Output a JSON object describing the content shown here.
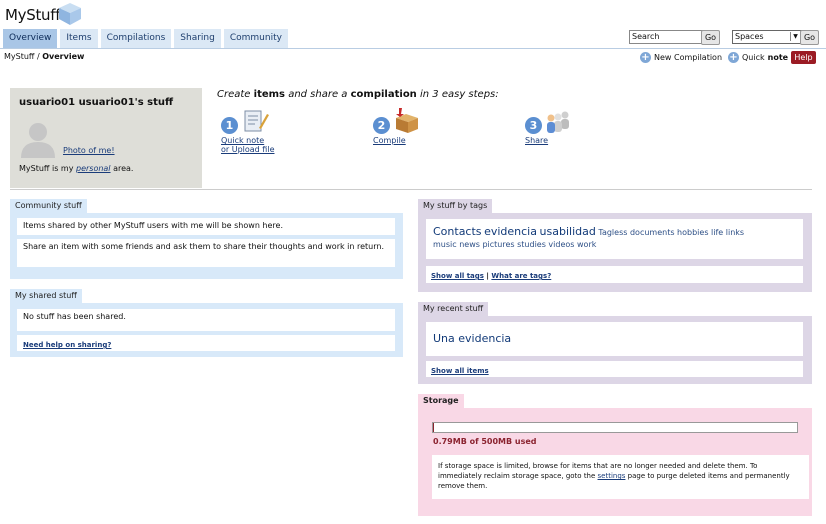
{
  "app": {
    "name": "MyStuff"
  },
  "tabs": [
    {
      "label": "Overview"
    },
    {
      "label": "Items"
    },
    {
      "label": "Compilations"
    },
    {
      "label": "Sharing"
    },
    {
      "label": "Community"
    }
  ],
  "search": {
    "value": "Search",
    "go": "Go"
  },
  "spaces": {
    "value": "Spaces",
    "go": "Go"
  },
  "breadcrumb": {
    "root": "MyStuff",
    "sep": " / ",
    "current": "Overview"
  },
  "actions": {
    "new_compilation": "New Compilation",
    "quick": "Quick",
    "note": "note",
    "help": "Help"
  },
  "user": {
    "name": "usuario01 usuario01's stuff",
    "photo_link": "Photo of me!",
    "personal_pre": "MyStuff is my ",
    "personal_word": "personal",
    "personal_post": " area."
  },
  "steps": {
    "pre1": "Create ",
    "items": "items",
    "pre2": " and share a ",
    "compilation": "compilation",
    "post": " in 3 easy steps:",
    "list": [
      {
        "num": "1",
        "line1": "Quick note",
        "line2": "or Upload file"
      },
      {
        "num": "2",
        "line1": "Compile",
        "line2": ""
      },
      {
        "num": "3",
        "line1": "Share",
        "line2": ""
      }
    ]
  },
  "community": {
    "title": "Community stuff",
    "line1": "Items shared by other MyStuff users with me will be shown here.",
    "line2": "Share an item with some friends and ask them to share their thoughts and work in return."
  },
  "shared": {
    "title": "My shared stuff",
    "empty": "No stuff has been shared.",
    "help": "Need help on sharing?"
  },
  "tags": {
    "title": "My stuff by tags",
    "big": [
      "Contacts",
      "evidencia",
      "usabilidad"
    ],
    "small_row1": [
      "Tagless",
      "documents",
      "hobbies",
      "life",
      "links"
    ],
    "small_row2": [
      "music",
      "news",
      "pictures",
      "studies",
      "videos",
      "work"
    ],
    "show_all": "Show all tags",
    "sep": " | ",
    "what": "What are tags?"
  },
  "recent": {
    "title": "My recent stuff",
    "item": "Una evidencia",
    "show_all": "Show all items"
  },
  "storage": {
    "title": "Storage",
    "used_label": "0.79MB of 500MB used",
    "used_fraction": 0.0016,
    "note_pre": "If storage space is limited, browse for items that are no longer needed and delete them. To immediately reclaim storage space, goto the ",
    "note_link": "settings",
    "note_post": " page to purge deleted items and permanently remove them."
  }
}
